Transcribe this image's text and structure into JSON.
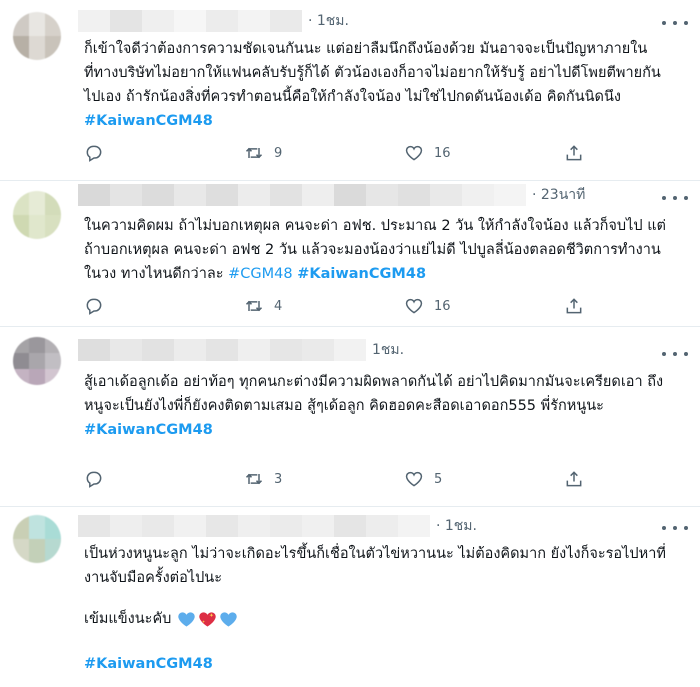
{
  "tweets": [
    {
      "time": "· 1ชม.",
      "text": "ก็เข้าใจดีว่าต้องการความชัดเจนกันนะ แต่อย่าลืมนึกถึงน้องด้วย มันอาจจะเป็นปัญหาภายในที่ทางบริษัทไม่อยากให้แฟนคลับรับรู้ก็ได้ ตัวน้องเองก็อาจไม่อยากให้รับรู้ อย่าไปดีโพยตีพายกันไปเอง ถ้ารักน้องสิ่งที่ควรทำตอนนี้คือให้กำลังใจน้อง ไม่ใช่ไปกดดันน้องเด้อ คิดกันนิดนึง ",
      "hashtags": [
        "#KaiwanCGM48"
      ],
      "replies": "",
      "retweets": "9",
      "likes": "16"
    },
    {
      "time": "· 23นาที",
      "text": "ในความคิดผม ถ้าไม่บอกเหตุผล คนจะด่า อฟช. ประมาณ 2 วัน ให้กำลังใจน้อง แล้วก็จบไป แต่ถ้าบอกเหตุผล คนจะด่า อฟช 2 วัน แล้วจะมองน้องว่าแย่ไม่ดี ไปบูลลี่น้องตลอดชีวิตการทำงานในวง ทางไหนดีกว่าละ ",
      "hashtags": [
        "#CGM48",
        "#KaiwanCGM48"
      ],
      "replies": "",
      "retweets": "4",
      "likes": "16"
    },
    {
      "time": "1ชม.",
      "text": "สู้เอาเด้อลูกเด้อ อย่าท้อๆ ทุกคนกะต่างมีความผิดพลาดกันได้ อย่าไปคิดมากมันจะเครียดเอา ถึงหนูจะเป็นยังไงพี่ก็ยังคงติดตามเสมอ สู้ๆเด้อลูก คิดฮอดคะสือดเอาดอก555 พี่รักหนูนะ",
      "hashtags": [
        "#KaiwanCGM48"
      ],
      "replies": "",
      "retweets": "3",
      "likes": "5"
    },
    {
      "time": "· 1ชม.",
      "text": "เป็นห่วงหนูนะลูก ไม่ว่าจะเกิดอะไรขึ้นก็เชื่อในตัวไข่หวานนะ ไม่ต้องคิดมาก ยังไงก็จะรอไปหาที่งานจับมือครั้งต่อไปนะ",
      "line2": "เข้มแข็งนะคับ",
      "hashtags": [
        "#KaiwanCGM48"
      ]
    }
  ],
  "colors": {
    "hashtag": "#1d9bf0",
    "muted": "#536471",
    "divider": "#e6ecf0"
  },
  "icons": [
    "reply-icon",
    "retweet-icon",
    "like-icon",
    "share-icon",
    "more-icon",
    "blue-heart-icon",
    "sparkling-heart-icon"
  ]
}
